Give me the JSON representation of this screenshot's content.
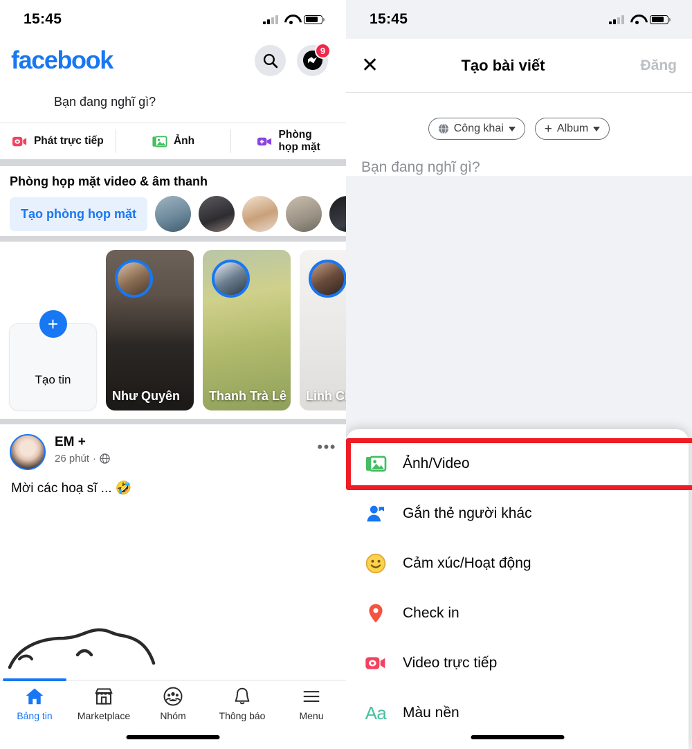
{
  "left": {
    "status": {
      "time": "15:45",
      "signal_icon": "cellular-signal-icon",
      "wifi_icon": "wifi-icon",
      "battery_icon": "battery-icon"
    },
    "header": {
      "logo": "facebook",
      "search_icon": "search-icon",
      "messenger_icon": "messenger-icon",
      "messenger_badge": "9"
    },
    "composer": {
      "placeholder": "Bạn đang nghĩ gì?"
    },
    "tabs": [
      {
        "label": "Phát trực tiếp",
        "icon": "live-video-icon"
      },
      {
        "label": "Ảnh",
        "icon": "photo-icon"
      },
      {
        "label": "Phòng",
        "label2": "họp mặt",
        "icon": "video-room-icon"
      }
    ],
    "rooms": {
      "title": "Phòng họp mặt video & âm thanh",
      "create_label": "Tạo phòng họp mặt",
      "avatars": [
        "avatar-1",
        "avatar-2",
        "avatar-3",
        "avatar-4",
        "avatar-5"
      ]
    },
    "stories": {
      "create": {
        "label": "Tạo tin",
        "icon": "plus-icon"
      },
      "items": [
        {
          "name": "Như Quyên"
        },
        {
          "name": "Thanh Trà Lê"
        },
        {
          "name": "Linh Ch"
        }
      ]
    },
    "post": {
      "author": "EM +",
      "time": "26 phút",
      "privacy_icon": "globe-icon",
      "menu_icon": "more-options-icon",
      "text": "Mời các hoạ sĩ ... 🤣"
    },
    "bottomnav": [
      {
        "label": "Bảng tin",
        "icon": "home-icon",
        "active": true
      },
      {
        "label": "Marketplace",
        "icon": "store-icon",
        "active": false
      },
      {
        "label": "Nhóm",
        "icon": "groups-icon",
        "active": false
      },
      {
        "label": "Thông báo",
        "icon": "bell-icon",
        "active": false
      },
      {
        "label": "Menu",
        "icon": "hamburger-menu-icon",
        "active": false
      }
    ]
  },
  "right": {
    "status": {
      "time": "15:45",
      "signal_icon": "cellular-signal-icon",
      "wifi_icon": "wifi-icon",
      "battery_icon": "battery-icon"
    },
    "header": {
      "close_icon": "close-icon",
      "title": "Tạo bài viết",
      "post_label": "Đăng"
    },
    "chips": [
      {
        "label": "Công khai",
        "icon": "globe-icon",
        "caret": "chevron-down-icon"
      },
      {
        "label": "Album",
        "icon": "plus-icon",
        "caret": "chevron-down-icon"
      }
    ],
    "composer": {
      "placeholder": "Bạn đang nghĩ gì?"
    },
    "sheet": {
      "options": [
        {
          "label": "Ảnh/Video",
          "icon": "photo-video-icon",
          "highlighted": true
        },
        {
          "label": "Gắn thẻ người khác",
          "icon": "tag-person-icon",
          "highlighted": false
        },
        {
          "label": "Cảm xúc/Hoạt động",
          "icon": "emoji-smiley-icon",
          "highlighted": false
        },
        {
          "label": "Check in",
          "icon": "location-pin-icon",
          "highlighted": false
        },
        {
          "label": "Video trực tiếp",
          "icon": "live-video-icon",
          "highlighted": false
        },
        {
          "label": "Màu nền",
          "icon": "background-color-icon",
          "highlighted": false
        }
      ]
    }
  },
  "colors": {
    "fb_blue": "#1877f2",
    "badge_red": "#f02849",
    "highlight_red": "#ee1c25",
    "green": "#45bd62",
    "orange": "#f5533d",
    "yellow": "#f7b928",
    "teal": "#44c0a0"
  }
}
